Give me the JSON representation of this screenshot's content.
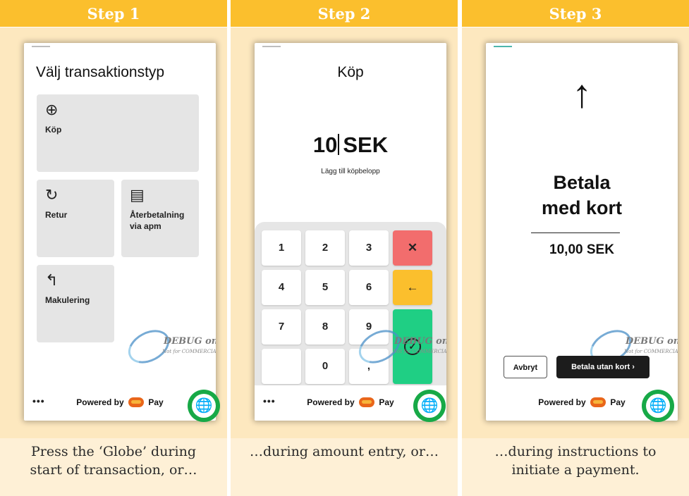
{
  "steps": [
    {
      "header": "Step 1",
      "caption": [
        "Press the ‘Globe’ during",
        "start of transaction, or…"
      ],
      "screen": {
        "title": "Välj transaktionstyp",
        "tiles": [
          {
            "icon": "⊕",
            "icon_name": "plus-circle-icon",
            "label": "Köp"
          },
          {
            "icon": "↻",
            "icon_name": "refresh-icon",
            "label": "Retur"
          },
          {
            "icon": "▤",
            "icon_name": "cash-register-icon",
            "label": "Återbetalning via apm"
          },
          {
            "icon": "↰",
            "icon_name": "undo-icon",
            "label": "Makulering"
          }
        ],
        "footer": {
          "menu": "•••",
          "powered_by": "Powered by",
          "pay": "Pay",
          "globe": "🌐"
        }
      }
    },
    {
      "header": "Step 2",
      "caption": [
        "…during amount entry, or…"
      ],
      "screen": {
        "title": "Köp",
        "amount": "10",
        "currency": "SEK",
        "hint": "Lägg till köpbelopp",
        "keys": [
          "1",
          "2",
          "3",
          "4",
          "5",
          "6",
          "7",
          "8",
          "9",
          "",
          "0",
          ","
        ],
        "clear_key": "✕",
        "back_key": "←",
        "ok_key": "✓",
        "footer": {
          "menu": "•••",
          "powered_by": "Powered by",
          "pay": "Pay",
          "globe": "🌐"
        }
      }
    },
    {
      "header": "Step 3",
      "caption": [
        "…during instructions to",
        "initiate a payment."
      ],
      "screen": {
        "arrow": "↑",
        "instruction": [
          "Betala",
          "med kort"
        ],
        "amount": "10,00 SEK",
        "cancel_button": "Avbryt",
        "pay_without_card_button": "Betala utan kort",
        "footer": {
          "powered_by": "Powered by",
          "pay": "Pay",
          "globe": "🌐"
        }
      }
    }
  ],
  "watermark": {
    "line1": "DEBUG only",
    "line2": "Not for COMMERCIAL"
  },
  "colors": {
    "header_bg": "#fbbf2d",
    "panel_bg": "#fde8bf",
    "caption_bg": "#fef0d6",
    "globe_highlight": "#17a947",
    "key_clear": "#f26d6d",
    "key_back": "#fbbf2d",
    "key_ok": "#1fcf84"
  }
}
